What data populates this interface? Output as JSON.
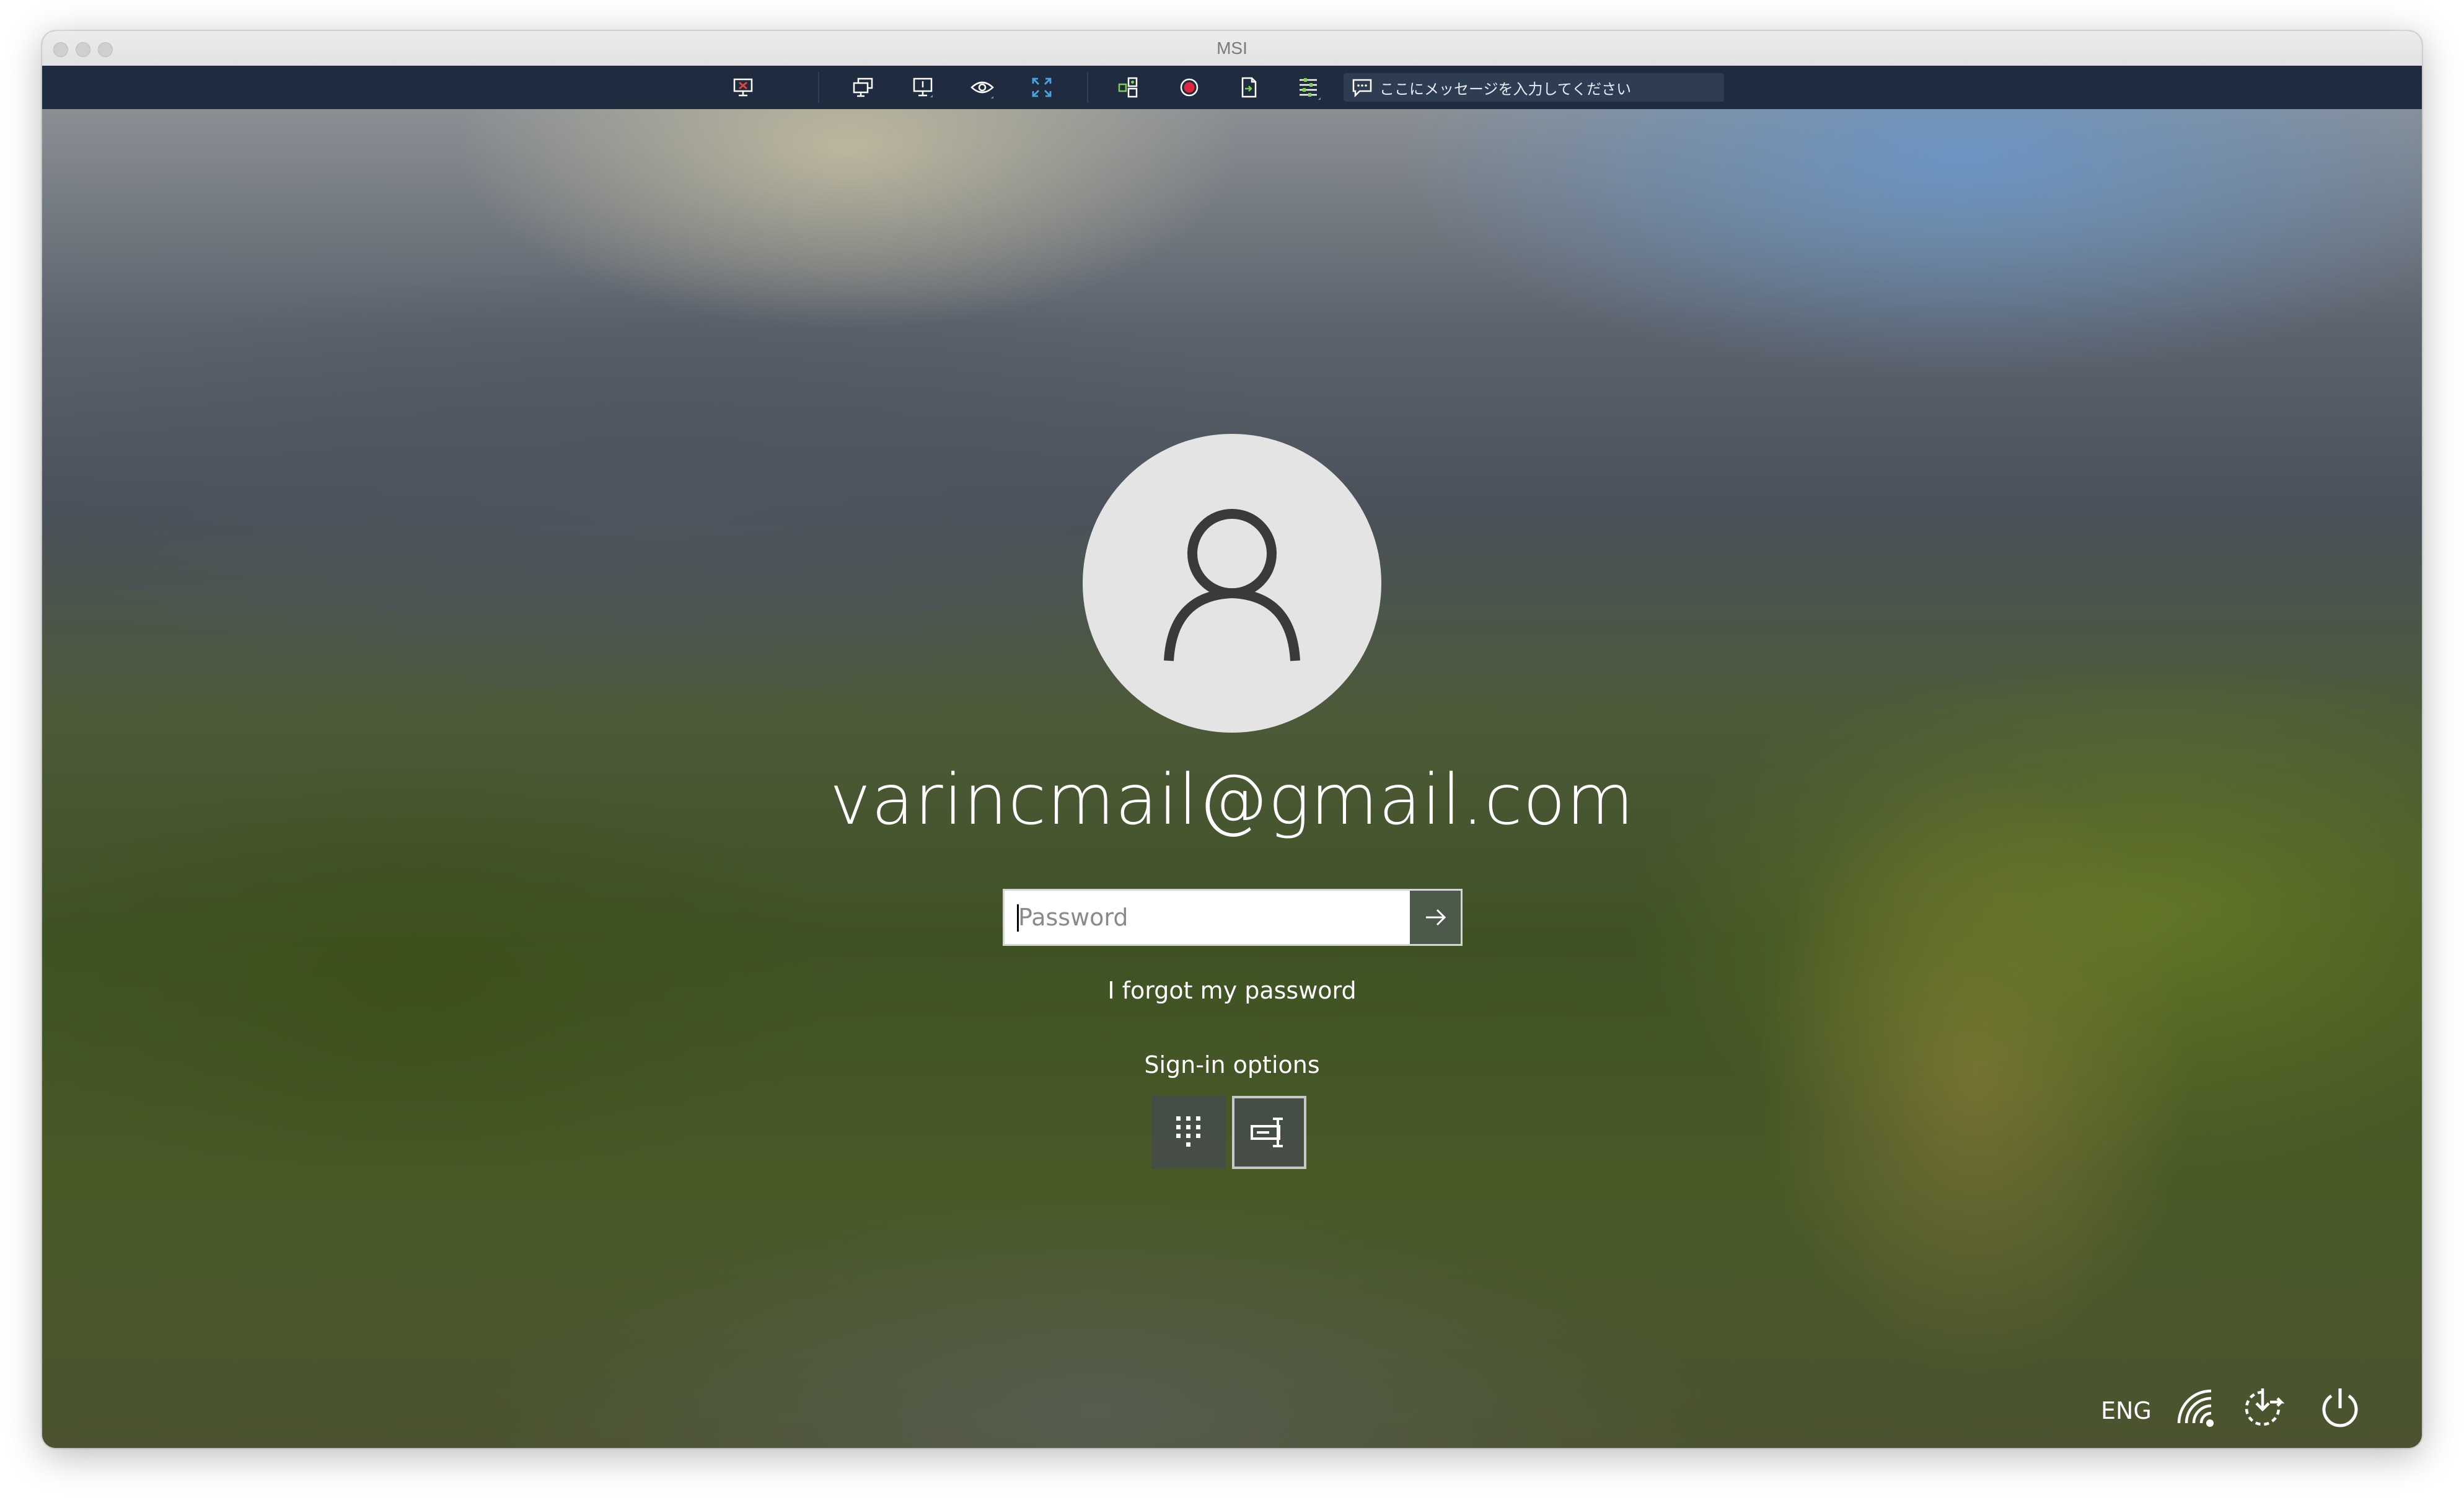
{
  "window": {
    "title": "MSI"
  },
  "toolbar": {
    "buttons": [
      {
        "name": "disconnect-icon"
      },
      {
        "name": "multi-monitor-icon"
      },
      {
        "name": "display-icon"
      },
      {
        "name": "view-only-eye-icon"
      },
      {
        "name": "fullscreen-icon"
      },
      {
        "name": "scaling-icon"
      },
      {
        "name": "record-icon"
      },
      {
        "name": "file-transfer-icon"
      },
      {
        "name": "settings-list-icon"
      }
    ],
    "message_placeholder": "ここにメッセージを入力してください"
  },
  "login": {
    "username": "varincmail@gmail.com",
    "password_placeholder": "Password",
    "password_value": "",
    "forgot_link": "I forgot my password",
    "signin_options_label": "Sign-in options",
    "options": [
      {
        "name": "pin-keypad-icon",
        "selected": false
      },
      {
        "name": "password-key-icon",
        "selected": true
      }
    ]
  },
  "status": {
    "language": "ENG",
    "icons": [
      "network-icon",
      "ease-of-access-icon",
      "power-icon"
    ]
  },
  "colors": {
    "toolbar_bg": "#1f2c3f",
    "avatar_bg": "#e4e4e4",
    "text": "#ffffff"
  }
}
